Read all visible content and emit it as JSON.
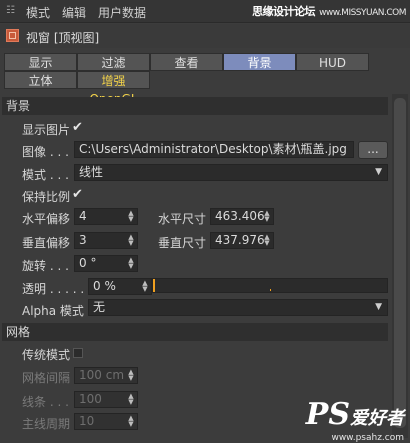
{
  "menubar": {
    "items": [
      "模式",
      "编辑",
      "用户数据"
    ]
  },
  "watermark": {
    "text_cn": "思缘设计论坛",
    "url": "www.MISSYUAN.COM"
  },
  "title": {
    "text": "视窗 [顶视图]"
  },
  "tabs": {
    "row1": [
      "显示",
      "过滤",
      "查看",
      "背景",
      "HUD"
    ],
    "row2": [
      "立体",
      "增强OpenGL"
    ],
    "active": "背景"
  },
  "background_section": {
    "header": "背景",
    "show_picture_label": "显示图片",
    "show_picture_checked": true,
    "image_label": "图像 . . . .",
    "image_path": "C:\\Users\\Administrator\\Desktop\\素材\\瓶盖.jpg",
    "browse_label": "...",
    "mode_label": "模式 . . . .",
    "mode_value": "线性",
    "keep_ratio_label": "保持比例",
    "keep_ratio_checked": true,
    "h_offset_label": "水平偏移",
    "h_offset_value": "4",
    "h_size_label": "水平尺寸",
    "h_size_value": "463.406",
    "v_offset_label": "垂直偏移",
    "v_offset_value": "3",
    "v_size_label": "垂直尺寸",
    "v_size_value": "437.976",
    "rotate_label": "旋转 . . . .",
    "rotate_value": "0 °",
    "transparency_label": "透明 . . . . .",
    "transparency_value": "0 %",
    "transparency_level": 0,
    "alpha_label": "Alpha 模式",
    "alpha_value": "无"
  },
  "grid_section": {
    "header": "网格",
    "classic_label": "传统模式",
    "classic_checked": false,
    "spacing_label": "网格间隔",
    "spacing_value": "100 cm",
    "lines_label": "线条 . . .",
    "lines_value": "100",
    "major_label": "主线周期",
    "major_value": "10"
  },
  "logo": {
    "ps": "PS",
    "cn": "爱好者",
    "url": "www.psahz.com"
  },
  "colors": {
    "accent_tab": "#7d8cbc",
    "highlight_text": "#f2d24a",
    "slider_marker": "#f0a020"
  }
}
